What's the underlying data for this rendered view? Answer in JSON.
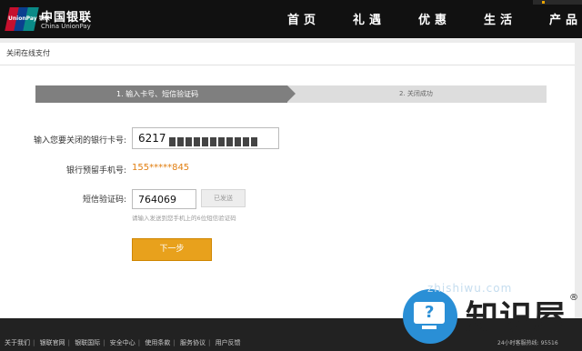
{
  "header": {
    "logo_text": "UnionPay 银联",
    "brand_cn": "中国银联",
    "brand_en": "China UnionPay",
    "nav": [
      "首页",
      "礼遇",
      "优惠",
      "生活",
      "产品"
    ]
  },
  "breadcrumb": "关闭在线支付",
  "steps": [
    "1. 输入卡号、短信验证码",
    "2. 关闭成功"
  ],
  "form": {
    "card_label": "输入您要关闭的银行卡号:",
    "card_value": "6217",
    "phone_label": "银行预留手机号:",
    "phone_value": "155*****845",
    "code_label": "短信验证码:",
    "code_value": "764069",
    "resend_label": "已发送",
    "hint": "请输入发送到您手机上的6位短信验证码",
    "next_label": "下一步"
  },
  "footer": {
    "links": [
      "关于我们",
      "银联官网",
      "银联国际",
      "安全中心",
      "使用条款",
      "服务协议",
      "用户反馈"
    ],
    "hotline": "24小时客服热线: 95516"
  },
  "watermark": {
    "text": "知识屋",
    "url": "zhishiwu.com",
    "registered": "®"
  }
}
